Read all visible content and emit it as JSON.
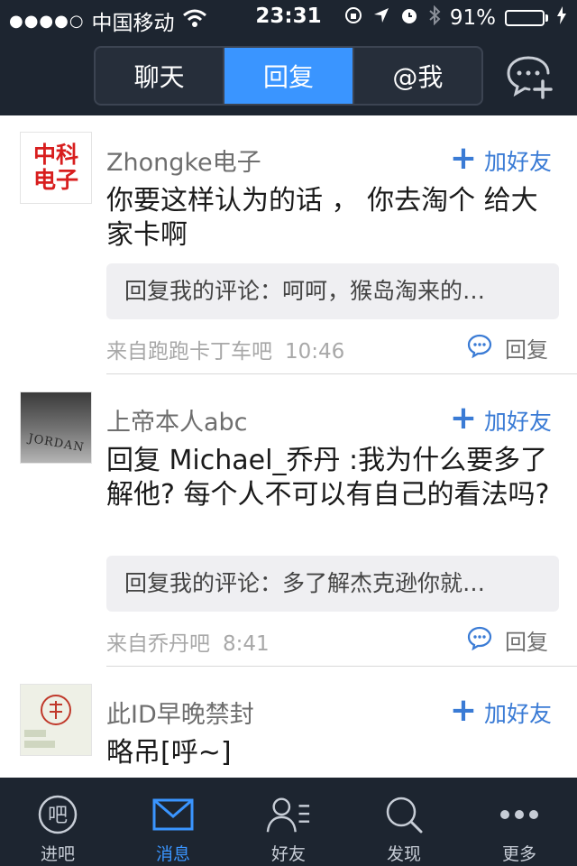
{
  "status_bar": {
    "signal_dots": "●●●●○",
    "carrier": "中国移动",
    "time": "23:31",
    "battery_percent": "91%",
    "battery_level": 0.91,
    "icons": [
      "wifi-icon",
      "rotation-lock-icon",
      "location-icon",
      "alarm-icon",
      "bluetooth-icon",
      "battery-icon",
      "charging-icon"
    ]
  },
  "tabs": [
    {
      "label": "聊天",
      "active": false
    },
    {
      "label": "回复",
      "active": true
    },
    {
      "label": "@我",
      "active": false
    }
  ],
  "posts": [
    {
      "avatar_text": [
        "中科",
        "电子"
      ],
      "username": "Zhongke电子",
      "add_friend": "加好友",
      "content": "你要这样认为的话 ， 你去淘个 给大家卡啊",
      "quote": "回复我的评论：呵呵，猴岛淘来的…",
      "source": "来自跑跑卡丁车吧",
      "time": "10:46",
      "reply": "回复"
    },
    {
      "avatar_text": [
        "JORDAN"
      ],
      "username": "上帝本人abc",
      "add_friend": "加好友",
      "content": "回复 Michael_乔丹 :我为什么要多了解他? 每个人不可以有自己的看法吗?",
      "quote": "回复我的评论：多了解杰克逊你就…",
      "source": "来自乔丹吧",
      "time": "8:41",
      "reply": "回复"
    },
    {
      "avatar_text": [],
      "username": "此ID早晚禁封",
      "add_friend": "加好友",
      "content": "略吊[呼~]"
    }
  ],
  "tabbar": [
    {
      "label": "进吧",
      "icon": "bar-icon",
      "active": false
    },
    {
      "label": "消息",
      "icon": "mail-icon",
      "active": true
    },
    {
      "label": "好友",
      "icon": "friends-icon",
      "active": false
    },
    {
      "label": "发现",
      "icon": "search-icon",
      "active": false
    },
    {
      "label": "更多",
      "icon": "more-icon",
      "active": false
    }
  ],
  "colors": {
    "header_bg": "#1d2530",
    "accent": "#3a95ff",
    "link": "#3a7bd5",
    "battery": "#4cd964"
  }
}
